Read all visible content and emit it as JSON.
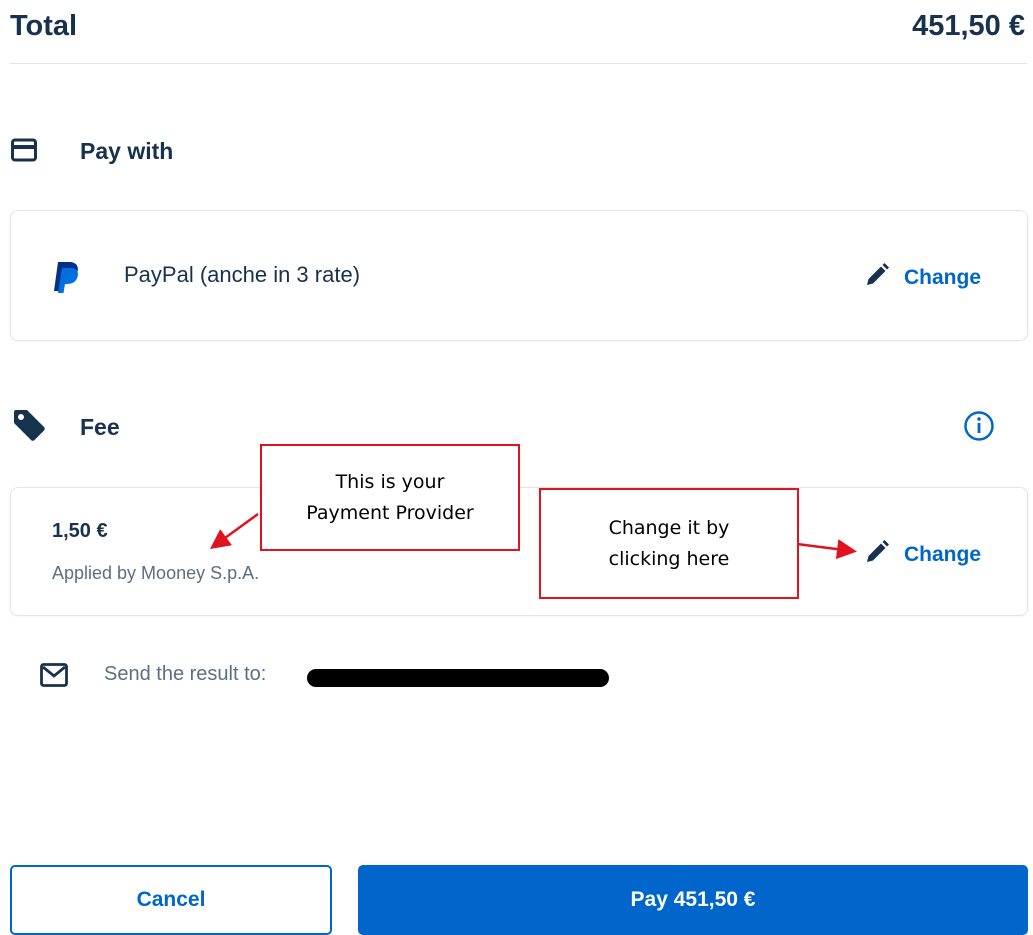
{
  "total": {
    "label": "Total",
    "amount": "451,50 €"
  },
  "pay_with": {
    "title": "Pay with",
    "icon": "credit-card-icon",
    "method_icon": "paypal-logo-icon",
    "method_name": "PayPal (anche in 3 rate)",
    "change_label": "Change"
  },
  "fee": {
    "title": "Fee",
    "icon": "tag-icon",
    "info_icon": "info-icon",
    "amount": "1,50 €",
    "applied_by": "Applied by Mooney S.p.A.",
    "change_label": "Change"
  },
  "annotations": {
    "provider_line1": "This is your",
    "provider_line2": "Payment Provider",
    "change_line1": "Change it by",
    "change_line2": "clicking here"
  },
  "email": {
    "icon": "envelope-icon",
    "label": "Send the result to:"
  },
  "actions": {
    "cancel_label": "Cancel",
    "pay_label": "Pay 451,50 €"
  },
  "colors": {
    "primary": "#0066cc",
    "text": "#17324d",
    "muted": "#5c6f82",
    "annotation_red": "#e0141e"
  }
}
